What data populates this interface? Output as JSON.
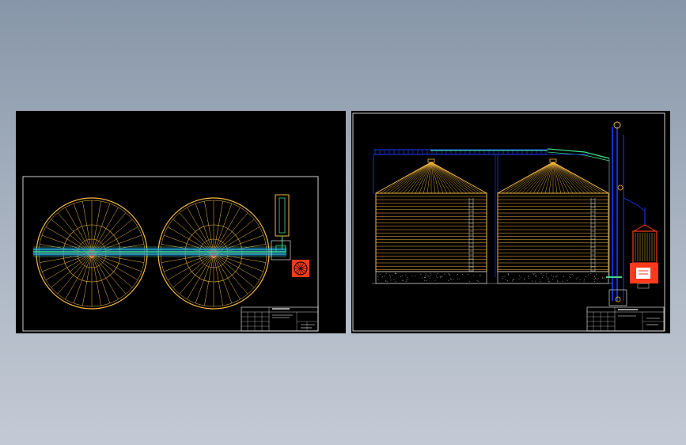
{
  "colors": {
    "background_top": "#8796a8",
    "background_bottom": "#c4cad5",
    "sheet": "#000000",
    "frame": "#ffffff",
    "silo": "#f5b942",
    "roof": "#f5b942",
    "conveyor": "#3ddc84",
    "conveyor_alt": "#2bd4d4",
    "structure": "#1a3cff",
    "equipment_red": "#ff3a1a",
    "gray": "#bfbfbf"
  },
  "drawings": [
    {
      "id": "plan-view",
      "silo_count": 2,
      "spokes_per_silo": 36
    },
    {
      "id": "elevation-view",
      "silo_count": 2,
      "roof_lines_per_silo": 28
    }
  ]
}
